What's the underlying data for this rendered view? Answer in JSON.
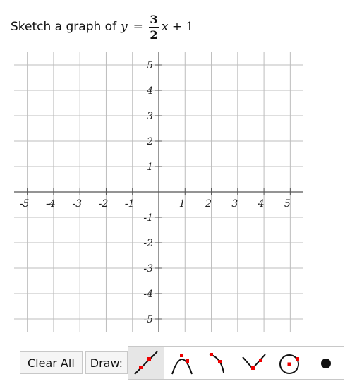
{
  "prompt": {
    "text": "Sketch a graph of",
    "y_var": "y",
    "equals": "=",
    "numerator": "3",
    "denominator": "2",
    "x_var": "x",
    "plus": "+",
    "constant": "1"
  },
  "graph": {
    "x_ticks": [
      "-5",
      "-4",
      "-3",
      "-2",
      "-1",
      "1",
      "2",
      "3",
      "4",
      "5"
    ],
    "y_ticks": [
      "5",
      "4",
      "3",
      "2",
      "1",
      "-1",
      "-2",
      "-3",
      "-4",
      "-5"
    ],
    "x_range": [
      -5.5,
      5.5
    ],
    "y_range": [
      -5.5,
      5.5
    ],
    "grid": true
  },
  "toolbar": {
    "clear_label": "Clear All",
    "draw_label": "Draw:",
    "tools": [
      {
        "icon": "line-tool-icon",
        "active": true
      },
      {
        "icon": "parabola-tool-icon",
        "active": false
      },
      {
        "icon": "curve-tool-icon",
        "active": false
      },
      {
        "icon": "absolute-value-tool-icon",
        "active": false
      },
      {
        "icon": "circle-tool-icon",
        "active": false
      },
      {
        "icon": "point-tool-icon",
        "active": false
      }
    ]
  }
}
